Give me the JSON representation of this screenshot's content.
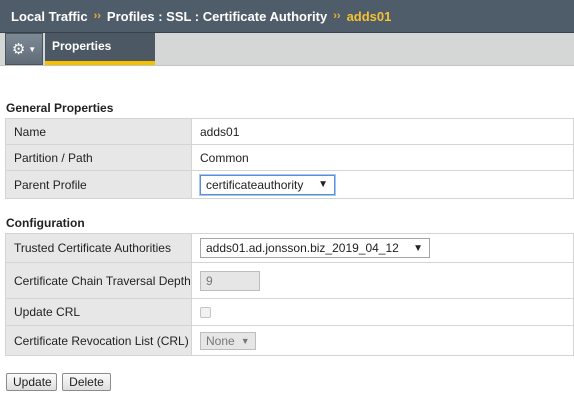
{
  "breadcrumb": {
    "items": [
      "Local Traffic",
      "Profiles : SSL : Certificate Authority"
    ],
    "separator": "››",
    "current": "adds01"
  },
  "toolbar": {
    "gear_icon": "gear-icon",
    "tab_label": "Properties"
  },
  "general": {
    "title": "General Properties",
    "name_label": "Name",
    "name_value": "adds01",
    "partition_label": "Partition / Path",
    "partition_value": "Common",
    "parent_label": "Parent Profile",
    "parent_value": "certificateauthority"
  },
  "configuration": {
    "title": "Configuration",
    "trusted_label": "Trusted Certificate Authorities",
    "trusted_value": "adds01.ad.jonsson.biz_2019_04_12",
    "depth_label": "Certificate Chain Traversal Depth",
    "depth_value": "9",
    "update_crl_label": "Update CRL",
    "update_crl_checked": false,
    "crl_label": "Certificate Revocation List (CRL)",
    "crl_value": "None"
  },
  "actions": {
    "update_label": "Update",
    "delete_label": "Delete"
  },
  "colors": {
    "header_bg": "#4f5d6b",
    "accent": "#f5c000",
    "label_bg": "#e7e7e7"
  }
}
